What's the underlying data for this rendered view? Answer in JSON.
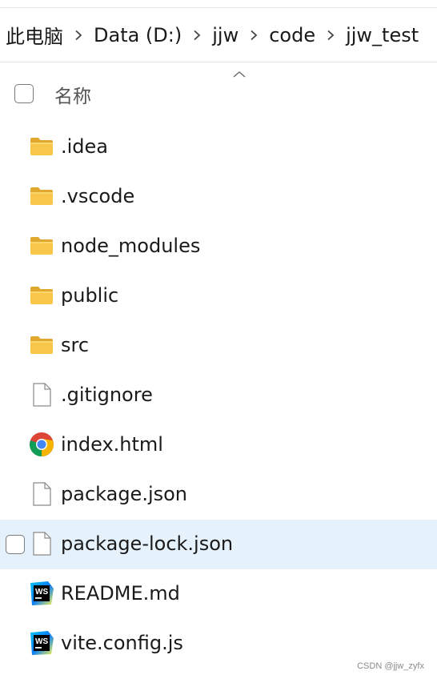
{
  "breadcrumb": {
    "items": [
      "此电脑",
      "Data (D:)",
      "jjw",
      "code",
      "jjw_test"
    ]
  },
  "header": {
    "column_label": "名称",
    "sort_indicator": "chevron-up-icon"
  },
  "files": [
    {
      "name": ".idea",
      "icon": "folder-icon"
    },
    {
      "name": ".vscode",
      "icon": "folder-icon"
    },
    {
      "name": "node_modules",
      "icon": "folder-icon"
    },
    {
      "name": "public",
      "icon": "folder-icon"
    },
    {
      "name": "src",
      "icon": "folder-icon"
    },
    {
      "name": ".gitignore",
      "icon": "file-icon"
    },
    {
      "name": "index.html",
      "icon": "chrome-icon"
    },
    {
      "name": "package.json",
      "icon": "file-icon"
    },
    {
      "name": "package-lock.json",
      "icon": "file-icon",
      "hovered": true
    },
    {
      "name": "README.md",
      "icon": "webstorm-icon"
    },
    {
      "name": "vite.config.js",
      "icon": "webstorm-icon"
    }
  ],
  "watermark": "CSDN @jjw_zyfx",
  "colors": {
    "hover_background": "#e5f1fb",
    "folder_yellow": "#f8c74a",
    "divider": "#e3e3e3"
  }
}
